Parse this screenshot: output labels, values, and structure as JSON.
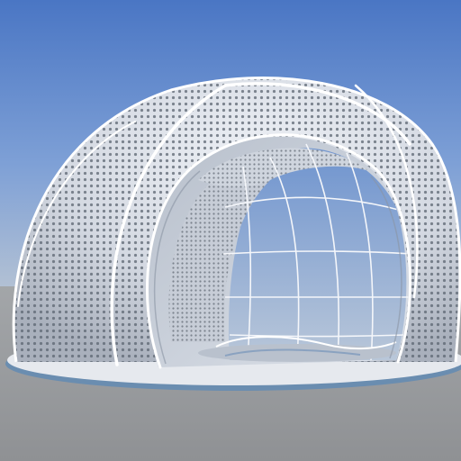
{
  "scene": {
    "subject": "perforated-shell-pavilion",
    "colors": {
      "sky_top": "#4a76c4",
      "sky_mid": "#7ea0d6",
      "sky_horizon": "#b6c3d4",
      "ground_far": "#a3a6a9",
      "ground_near": "#8f9194",
      "shell_light": "#eef1f6",
      "shell_shade": "#c9ced8",
      "shell_dark": "#a9b0bc",
      "perforation": "#5b6470",
      "rib": "#ffffff",
      "platform_top": "#e6e9ee",
      "platform_edge": "#6a8db0",
      "interior": "#d2d8e2",
      "frame_line": "#f4f6fa"
    }
  }
}
